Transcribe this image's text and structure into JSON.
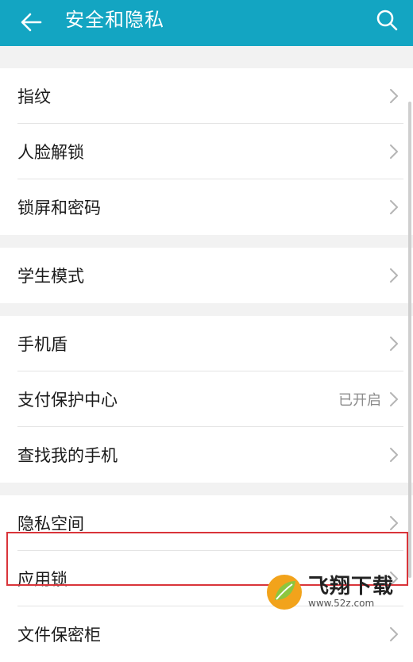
{
  "header": {
    "title": "安全和隐私",
    "back_icon": "arrow-left-icon",
    "search_icon": "search-icon",
    "color": "#13a5c2"
  },
  "groups": [
    {
      "items": [
        {
          "label": "指纹"
        },
        {
          "label": "人脸解锁"
        },
        {
          "label": "锁屏和密码"
        }
      ]
    },
    {
      "items": [
        {
          "label": "学生模式"
        }
      ]
    },
    {
      "items": [
        {
          "label": "手机盾"
        },
        {
          "label": "支付保护中心",
          "status": "已开启"
        },
        {
          "label": "查找我的手机"
        }
      ]
    },
    {
      "items": [
        {
          "label": "隐私空间"
        },
        {
          "label": "应用锁"
        },
        {
          "label": "文件保密柜"
        }
      ]
    }
  ],
  "highlight_color": "#d9343a",
  "watermark": {
    "title": "飞翔下载",
    "url": "www.52z.com"
  }
}
